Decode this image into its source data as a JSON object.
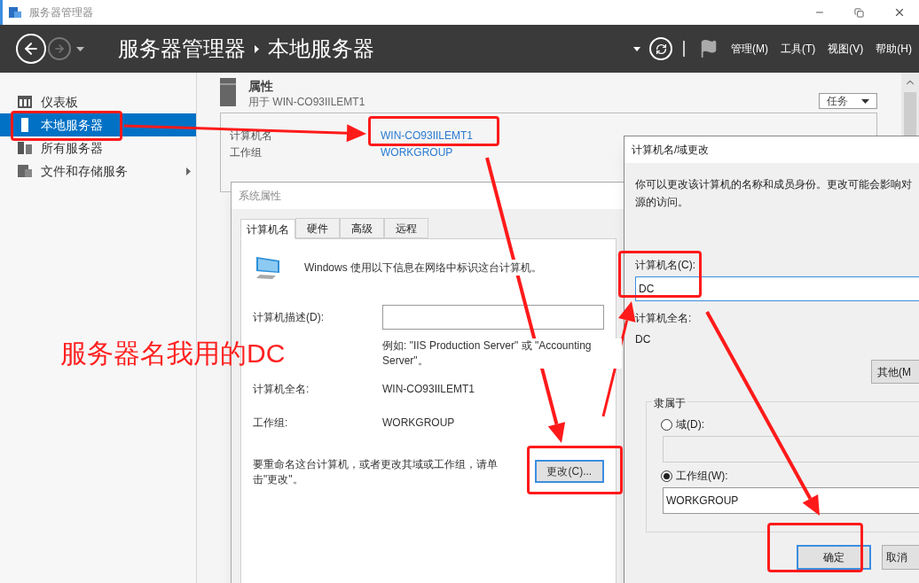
{
  "window": {
    "title": "服务器管理器"
  },
  "header": {
    "breadcrumb": [
      "服务器管理器",
      "本地服务器"
    ],
    "menus": [
      "管理(M)",
      "工具(T)",
      "视图(V)",
      "帮助(H)"
    ]
  },
  "sidebar": {
    "items": [
      {
        "label": "仪表板",
        "selected": false,
        "kind": "dashboard"
      },
      {
        "label": "本地服务器",
        "selected": true,
        "kind": "server"
      },
      {
        "label": "所有服务器",
        "selected": false,
        "kind": "servers"
      },
      {
        "label": "文件和存储服务",
        "selected": false,
        "kind": "storage",
        "expandable": true
      }
    ]
  },
  "properties": {
    "title": "属性",
    "subtitle": "用于 WIN-CO93IILEMT1",
    "tasks_button": "任务",
    "fields": [
      {
        "label": "计算机名",
        "value": "WIN-CO93IILEMT1"
      },
      {
        "label": "工作组",
        "value": "WORKGROUP"
      }
    ]
  },
  "system_properties": {
    "title": "系统属性",
    "tabs": [
      {
        "label": "计算机名",
        "selected": true
      },
      {
        "label": "硬件",
        "selected": false
      },
      {
        "label": "高级",
        "selected": false
      },
      {
        "label": "远程",
        "selected": false
      }
    ],
    "intro": "Windows 使用以下信息在网络中标识这台计算机。",
    "description_label": "计算机描述(D):",
    "description_hint": "例如: \"IIS Production Server\" 或 \"Accounting Server\"。",
    "full_name_label": "计算机全名:",
    "full_name": "WIN-CO93IILEMT1",
    "workgroup_label": "工作组:",
    "workgroup": "WORKGROUP",
    "rename_text": "要重命名这台计算机，或者更改其域或工作组，请单击\"更改\"。",
    "change_button": "更改(C)..."
  },
  "rename_dialog": {
    "title": "计算机名/域更改",
    "intro_lines": [
      "你可以更改该计算机的名称和成员身份。更改可能会影响对",
      "源的访问。"
    ],
    "name_label": "计算机名(C):",
    "name_value": "DC",
    "full_name_label": "计算机全名:",
    "full_name": "DC",
    "more_button": "其他(M",
    "member_of": {
      "title": "隶属于",
      "options": [
        {
          "label": "域(D):",
          "selected": false
        },
        {
          "label": "工作组(W):",
          "selected": true,
          "value": "WORKGROUP"
        }
      ]
    },
    "buttons": [
      {
        "label": "确定",
        "kind": "default"
      },
      {
        "label": "取消",
        "kind": "normal"
      }
    ]
  },
  "annotation": {
    "note": "服务器名我用的DC"
  }
}
